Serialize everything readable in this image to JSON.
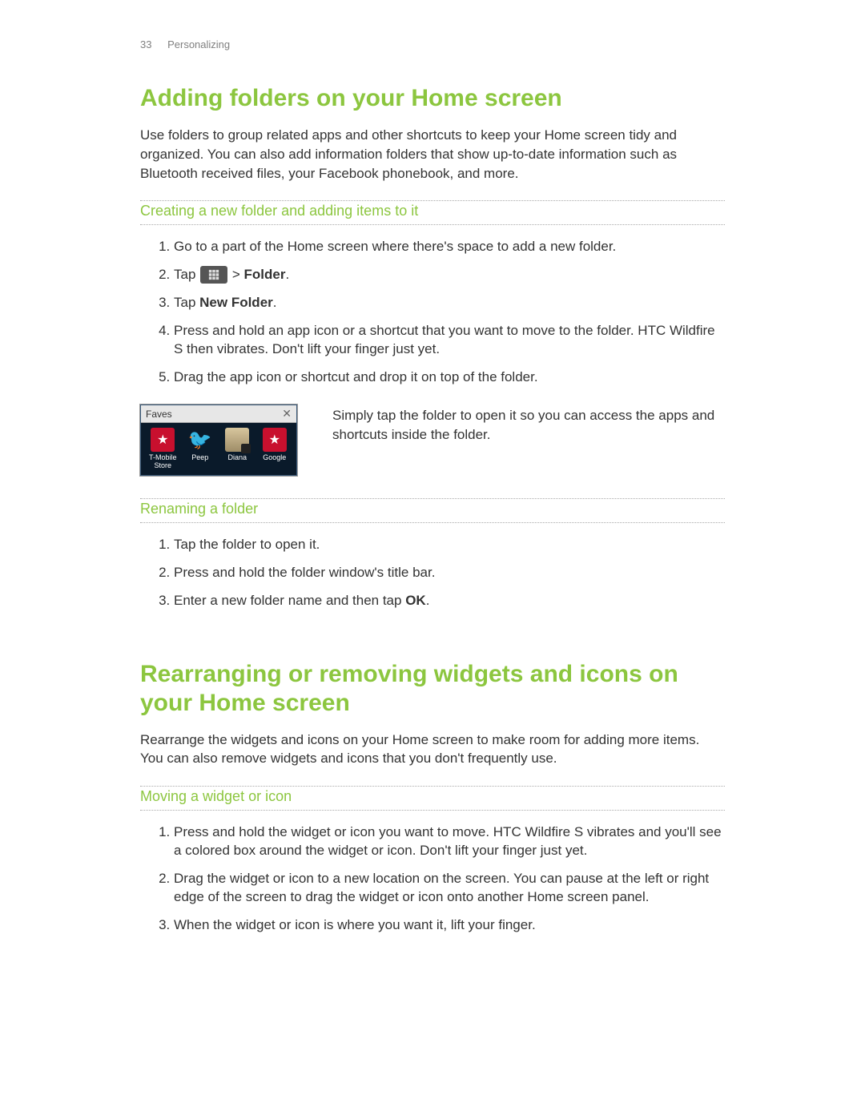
{
  "header": {
    "page_number": "33",
    "chapter_title": "Personalizing"
  },
  "section1": {
    "title": "Adding folders on your Home screen",
    "intro": "Use folders to group related apps and other shortcuts to keep your Home screen tidy and organized. You can also add information folders that show up-to-date information such as Bluetooth received files, your Facebook phonebook, and more.",
    "sub1": {
      "title": "Creating a new folder and adding items to it",
      "steps": {
        "s1": "Go to a part of the Home screen where there's space to add a new folder.",
        "s2_a": "Tap ",
        "s2_b": " > ",
        "s2_c": "Folder",
        "s2_d": ".",
        "s3_a": "Tap ",
        "s3_b": "New Folder",
        "s3_c": ".",
        "s4": "Press and hold an app icon or a shortcut that you want to move to the folder. HTC Wildfire S then vibrates. Don't lift your finger just yet.",
        "s5": "Drag the app icon or shortcut and drop it on top of the folder."
      },
      "side_text": "Simply tap the folder to open it so you can access the apps and shortcuts inside the folder.",
      "popup": {
        "title": "Faves",
        "apps": {
          "a1": "T-Mobile Store",
          "a2": "Peep",
          "a3": "Diana",
          "a4": "Google"
        }
      }
    },
    "sub2": {
      "title": "Renaming a folder",
      "steps": {
        "s1": "Tap the folder to open it.",
        "s2": "Press and hold the folder window's title bar.",
        "s3_a": "Enter a new folder name and then tap ",
        "s3_b": "OK",
        "s3_c": "."
      }
    }
  },
  "section2": {
    "title": "Rearranging or removing widgets and icons on your Home screen",
    "intro": "Rearrange the widgets and icons on your Home screen to make room for adding more items. You can also remove widgets and icons that you don't frequently use.",
    "sub1": {
      "title": "Moving a widget or icon",
      "steps": {
        "s1": "Press and hold the widget or icon you want to move. HTC Wildfire S vibrates and you'll see a colored box around the widget or icon. Don't lift your finger just yet.",
        "s2": "Drag the widget or icon to a new location on the screen. You can pause at the left or right edge of the screen to drag the widget or icon onto another Home screen panel.",
        "s3": "When the widget or icon is where you want it, lift your finger."
      }
    }
  }
}
